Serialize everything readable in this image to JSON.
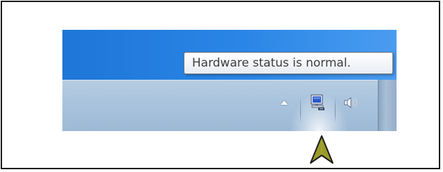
{
  "tooltip": {
    "text": "Hardware status is normal."
  },
  "tray": {
    "icons": [
      {
        "name": "show-hidden-icons",
        "icon": "triangle-up-icon"
      },
      {
        "name": "hardware-status",
        "icon": "computer-monitor-icon"
      },
      {
        "name": "volume",
        "icon": "speaker-icon"
      }
    ]
  },
  "colors": {
    "desktop": "#2a86e6",
    "taskbar": "#a9c3dd",
    "arrow_fill": "#9a9a2a",
    "tooltip_text": "#3c3c3c"
  }
}
